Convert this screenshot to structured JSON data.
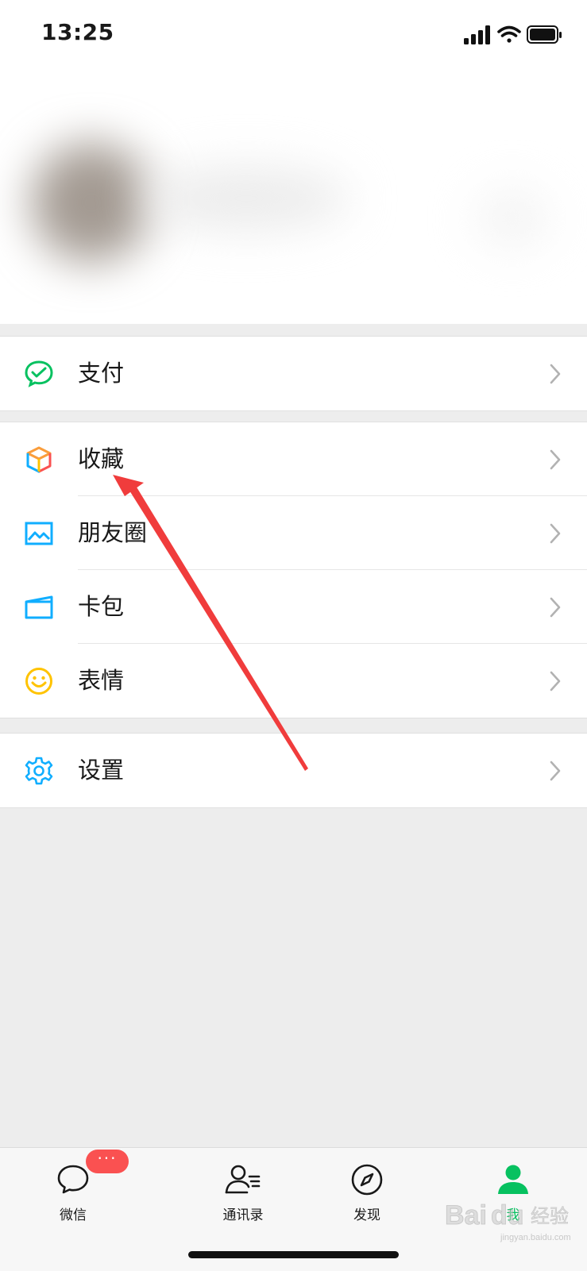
{
  "status_bar": {
    "time": "13:25"
  },
  "menu_groups": [
    {
      "items": [
        {
          "label": "支付",
          "icon": "wechat-pay-icon"
        }
      ]
    },
    {
      "items": [
        {
          "label": "收藏",
          "icon": "favorites-cube-icon"
        },
        {
          "label": "朋友圈",
          "icon": "moments-picture-icon"
        },
        {
          "label": "卡包",
          "icon": "card-wallet-icon"
        },
        {
          "label": "表情",
          "icon": "smiley-icon"
        }
      ]
    },
    {
      "items": [
        {
          "label": "设置",
          "icon": "gear-icon"
        }
      ]
    }
  ],
  "tab_bar": {
    "badge": "···",
    "tabs": [
      {
        "label": "微信",
        "icon": "chat-bubble-icon",
        "active": false
      },
      {
        "label": "通讯录",
        "icon": "contacts-icon",
        "active": false
      },
      {
        "label": "发现",
        "icon": "compass-icon",
        "active": false
      },
      {
        "label": "我",
        "icon": "person-icon",
        "active": true
      }
    ]
  },
  "watermark": {
    "text": "Baidu经验",
    "subtext": "jingyan.baidu.com"
  },
  "colors": {
    "accent_green": "#07c160",
    "badge_red": "#fa5151",
    "annotation_red": "#f03c3c",
    "background": "#ededed"
  }
}
